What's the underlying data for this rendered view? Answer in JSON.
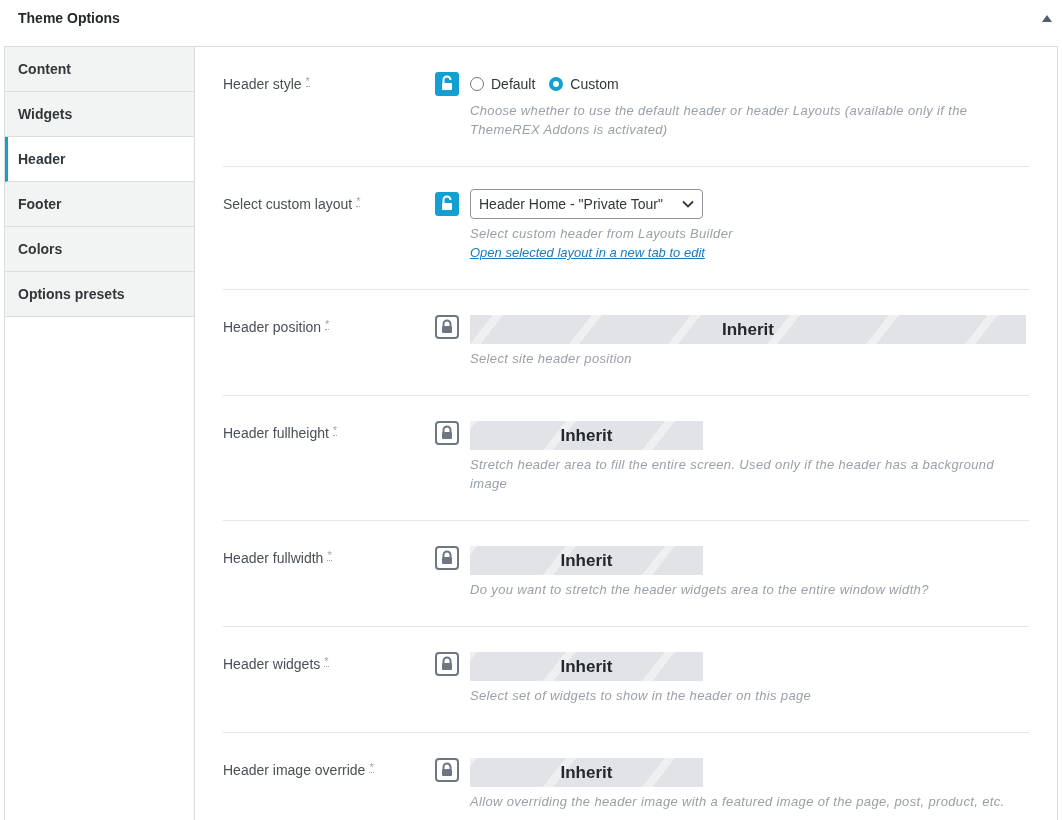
{
  "panel": {
    "title": "Theme Options",
    "expanded": true
  },
  "tabs": [
    {
      "label": "Content",
      "selected": false
    },
    {
      "label": "Widgets",
      "selected": false
    },
    {
      "label": "Header",
      "selected": true
    },
    {
      "label": "Footer",
      "selected": false
    },
    {
      "label": "Colors",
      "selected": false
    },
    {
      "label": "Options presets",
      "selected": false
    }
  ],
  "options": [
    {
      "kind": "radio",
      "label": "Header style",
      "mark": "*",
      "locked": false,
      "choices": [
        {
          "label": "Default",
          "selected": false
        },
        {
          "label": "Custom",
          "selected": true
        }
      ],
      "description": "Choose whether to use the default header or header Layouts (available only if the ThemeREX Addons is activated)"
    },
    {
      "kind": "select",
      "label": "Select custom layout",
      "mark": "*",
      "locked": false,
      "value": "Header Home - \"Private Tour\"",
      "description": "Select custom header from Layouts Builder",
      "link": "Open selected layout in a new tab to edit"
    },
    {
      "kind": "inherit",
      "label": "Header position",
      "mark": "*",
      "locked": true,
      "wide": true,
      "value": "Inherit",
      "description": "Select site header position"
    },
    {
      "kind": "inherit",
      "label": "Header fullheight",
      "mark": "*",
      "locked": true,
      "wide": false,
      "value": "Inherit",
      "description": "Stretch header area to fill the entire screen. Used only if the header has a background image"
    },
    {
      "kind": "inherit",
      "label": "Header fullwidth",
      "mark": "*",
      "locked": true,
      "wide": false,
      "value": "Inherit",
      "description": "Do you want to stretch the header widgets area to the entire window width?"
    },
    {
      "kind": "inherit",
      "label": "Header widgets",
      "mark": "*",
      "locked": true,
      "wide": false,
      "value": "Inherit",
      "description": "Select set of widgets to show in the header on this page"
    },
    {
      "kind": "inherit",
      "label": "Header image override",
      "mark": "*",
      "locked": true,
      "wide": false,
      "value": "Inherit",
      "description": "Allow overriding the header image with a featured image of the page, post, product, etc."
    }
  ]
}
